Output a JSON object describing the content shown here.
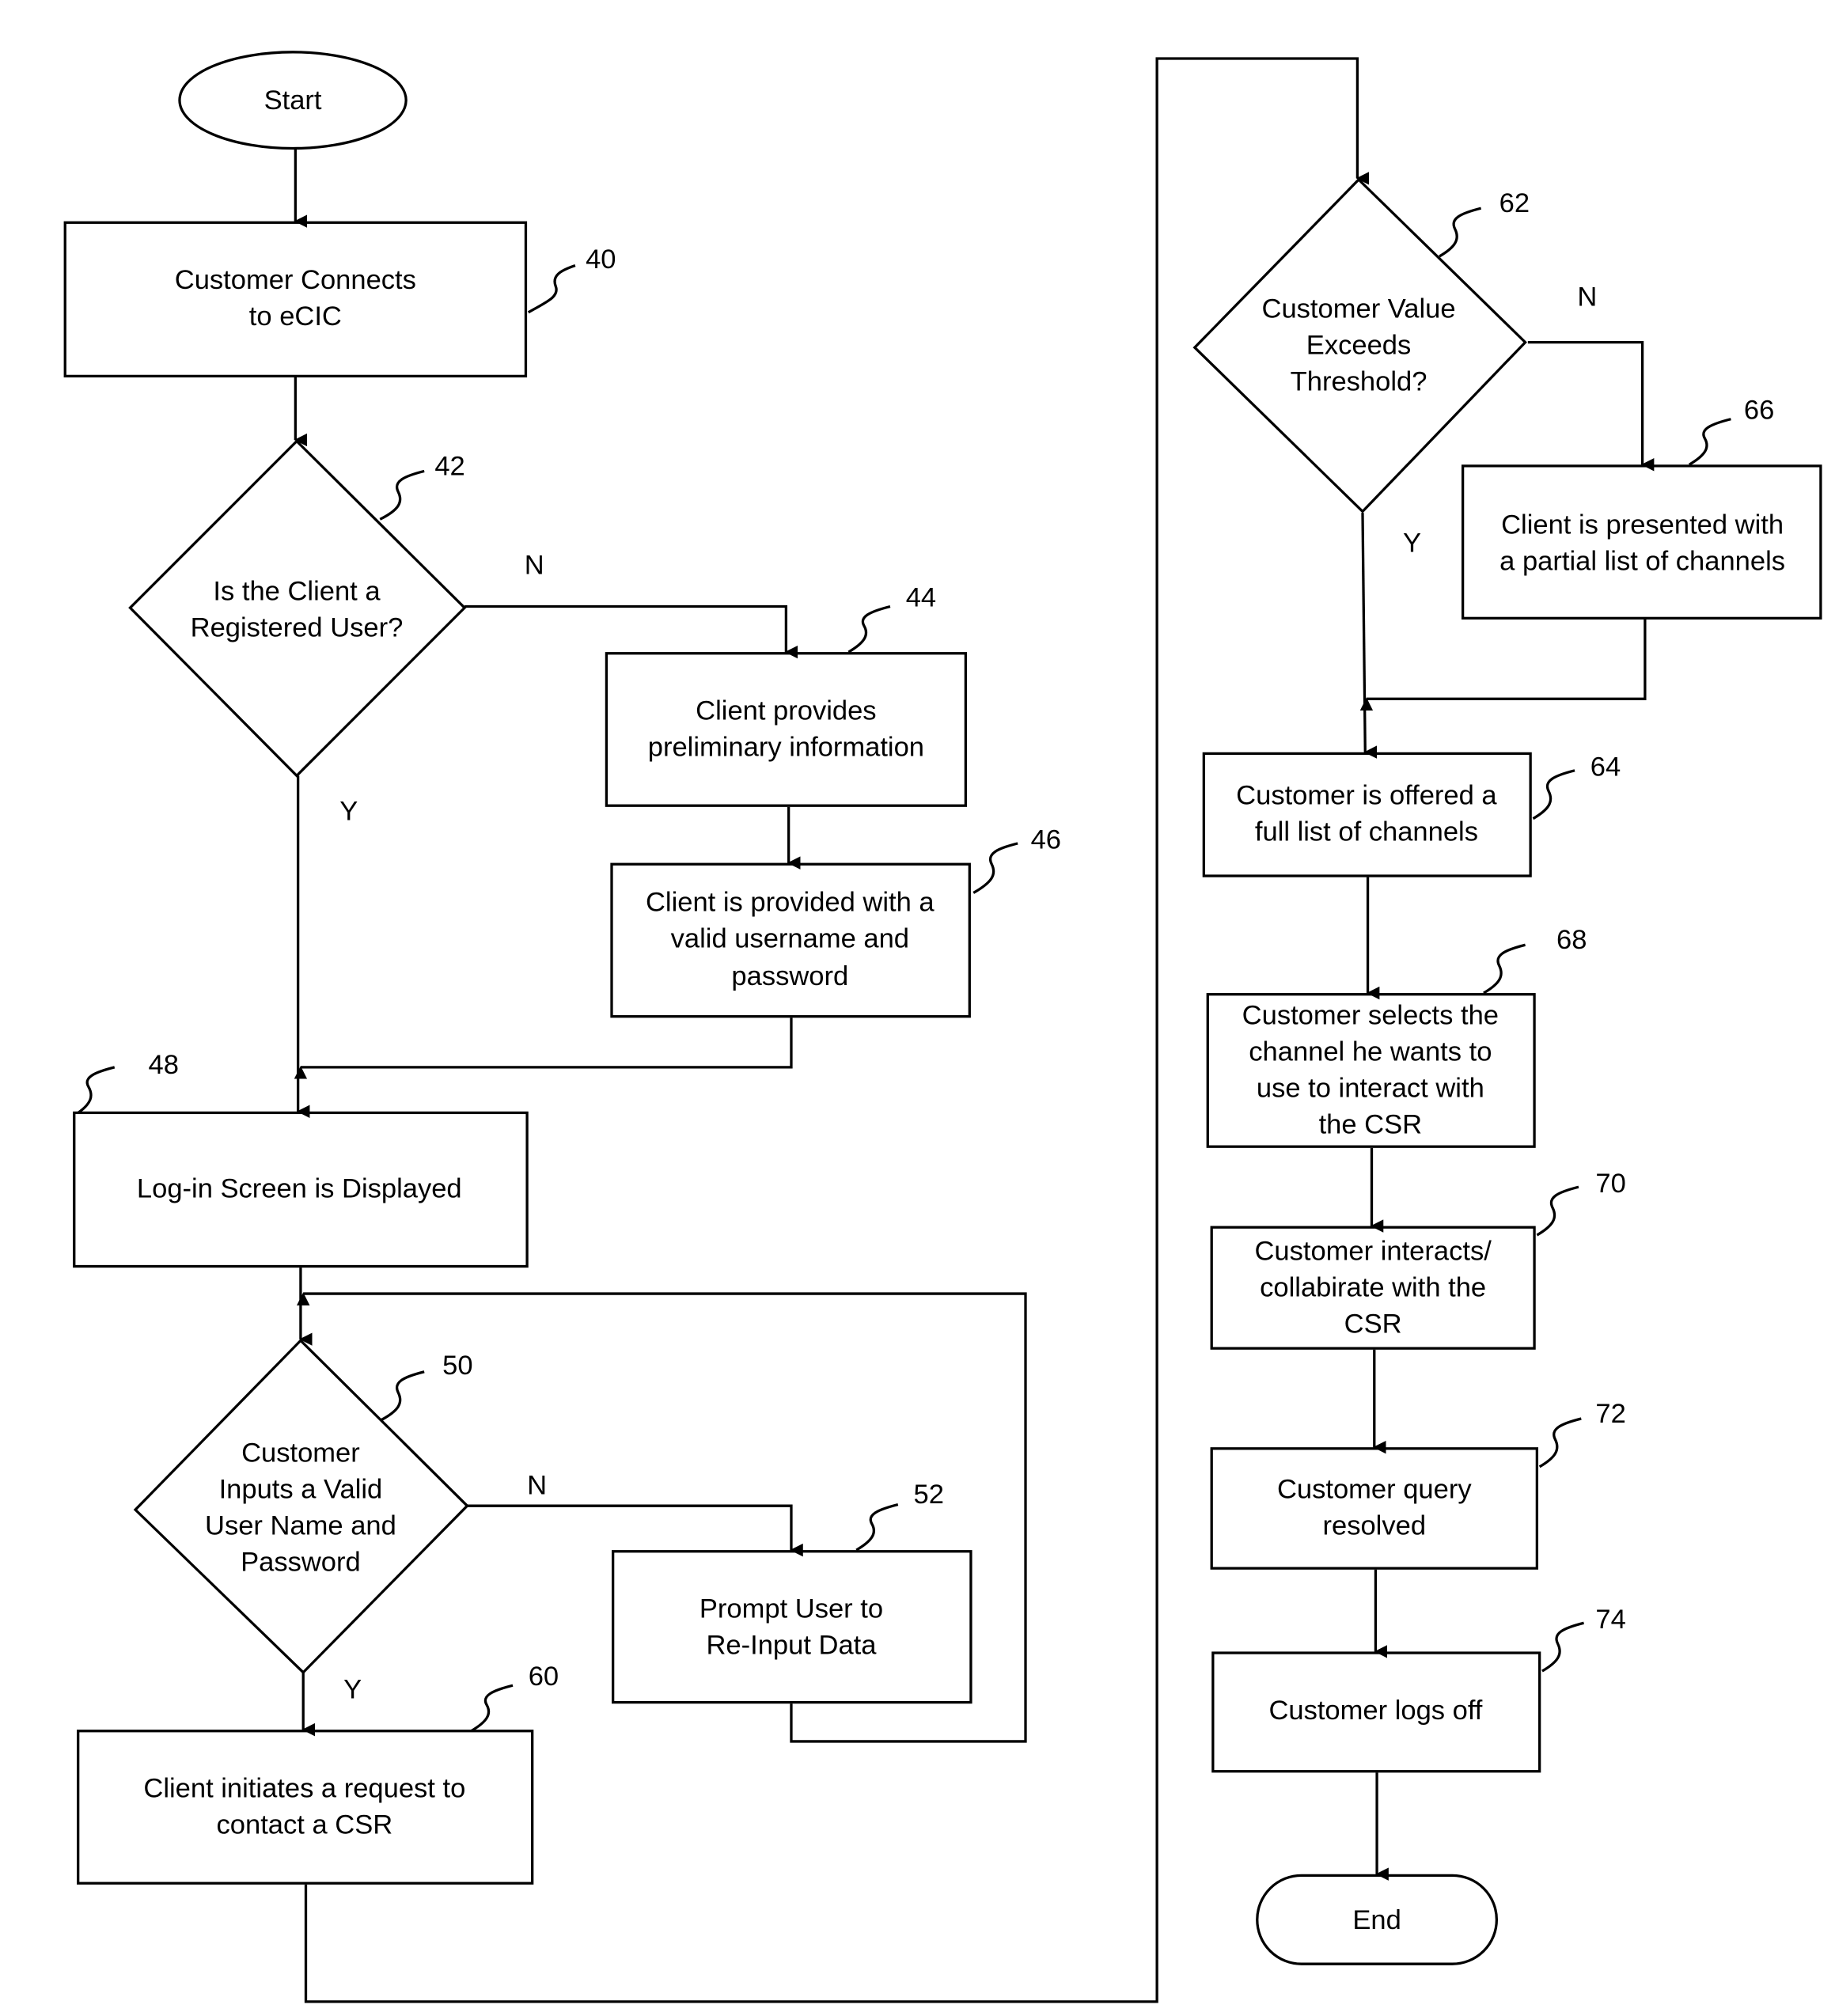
{
  "diagram": {
    "type": "flowchart",
    "terminals": {
      "start": "Start",
      "end": "End"
    },
    "nodes": {
      "n40": {
        "ref": "40",
        "lines": [
          "Customer Connects",
          "to eCIC"
        ]
      },
      "n42": {
        "ref": "42",
        "lines": [
          "Is the Client a",
          "Registered User?"
        ]
      },
      "n44": {
        "ref": "44",
        "lines": [
          "Client provides",
          "preliminary information"
        ]
      },
      "n46": {
        "ref": "46",
        "lines": [
          "Client is provided with a",
          "valid username and",
          "password"
        ]
      },
      "n48": {
        "ref": "48",
        "lines": [
          "Log-in Screen is Displayed"
        ]
      },
      "n50": {
        "ref": "50",
        "lines": [
          "Customer",
          "Inputs a Valid",
          "User Name and",
          "Password"
        ]
      },
      "n52": {
        "ref": "52",
        "lines": [
          "Prompt User to",
          "Re-Input Data"
        ]
      },
      "n60": {
        "ref": "60",
        "lines": [
          "Client initiates a request to",
          "contact a CSR"
        ]
      },
      "n62": {
        "ref": "62",
        "lines": [
          "Customer Value",
          "Exceeds",
          "Threshold?"
        ]
      },
      "n64": {
        "ref": "64",
        "lines": [
          "Customer is offered a",
          "full list of channels"
        ]
      },
      "n66": {
        "ref": "66",
        "lines": [
          "Client is presented with",
          "a partial list of channels"
        ]
      },
      "n68": {
        "ref": "68",
        "lines": [
          "Customer selects the",
          "channel he wants to",
          "use to interact with",
          "the CSR"
        ]
      },
      "n70": {
        "ref": "70",
        "lines": [
          "Customer interacts/",
          "collabirate with the",
          "CSR"
        ]
      },
      "n72": {
        "ref": "72",
        "lines": [
          "Customer query",
          "resolved"
        ]
      },
      "n74": {
        "ref": "74",
        "lines": [
          "Customer logs off"
        ]
      }
    },
    "branch_labels": {
      "n42_no": "N",
      "n42_yes": "Y",
      "n50_no": "N",
      "n50_yes": "Y",
      "n62_no": "N",
      "n62_yes": "Y"
    }
  }
}
